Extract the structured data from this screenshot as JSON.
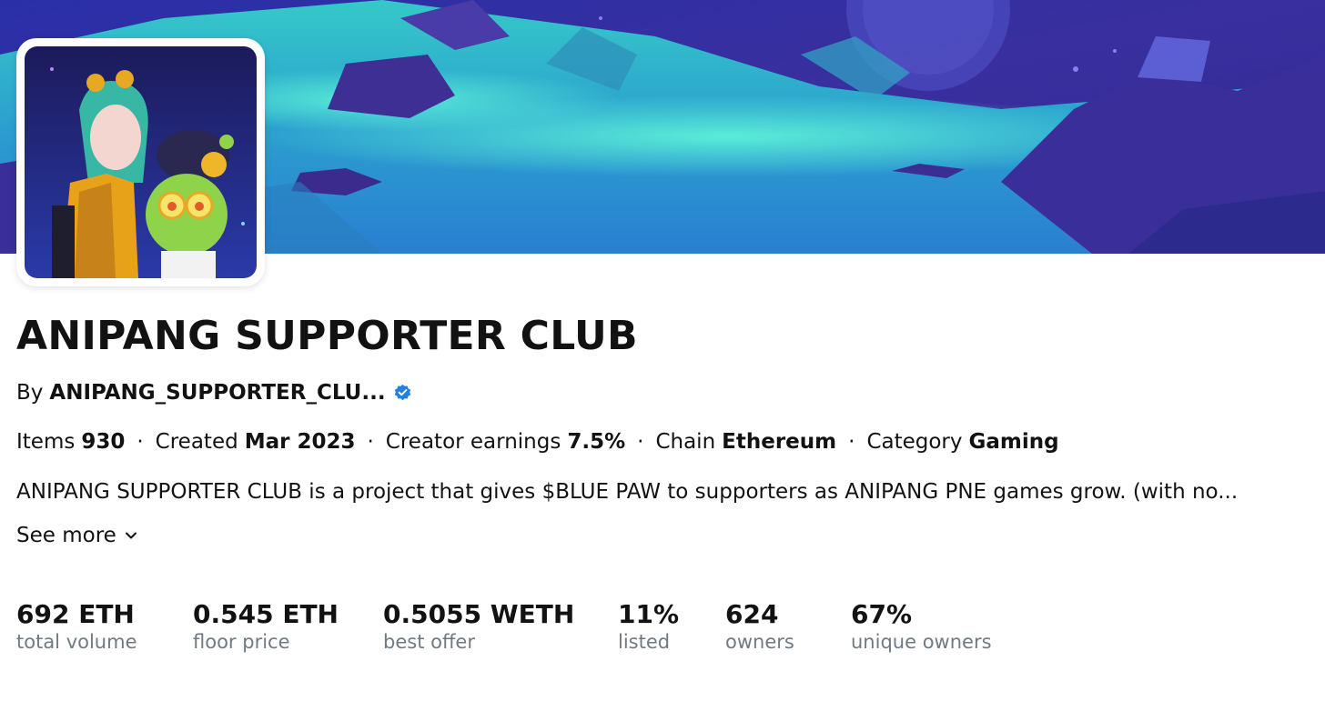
{
  "collection": {
    "title": "ANIPANG SUPPORTER CLUB",
    "by_label": "By",
    "creator": "ANIPANG_SUPPORTER_CLU...",
    "verified_icon": "verified-badge-icon"
  },
  "meta": [
    {
      "label": "Items",
      "value": "930"
    },
    {
      "label": "Created",
      "value": "Mar 2023"
    },
    {
      "label": "Creator earnings",
      "value": "7.5%"
    },
    {
      "label": "Chain",
      "value": "Ethereum"
    },
    {
      "label": "Category",
      "value": "Gaming"
    }
  ],
  "meta_separator": "·",
  "description": "ANIPANG SUPPORTER CLUB is a project that gives $BLUE PAW to supporters as ANIPANG PNE games grow. (with no...",
  "see_more_label": "See more",
  "stats": [
    {
      "value": "692 ETH",
      "label": "total volume"
    },
    {
      "value": "0.545 ETH",
      "label": "floor price"
    },
    {
      "value": "0.5055 WETH",
      "label": "best offer"
    },
    {
      "value": "11%",
      "label": "listed"
    },
    {
      "value": "624",
      "label": "owners"
    },
    {
      "value": "67%",
      "label": "unique owners"
    }
  ],
  "colors": {
    "text": "#121212",
    "muted": "#707a83",
    "verified": "#2081e2",
    "banner_sky": "#3b2fa8",
    "banner_glow": "#3ee0d0"
  }
}
